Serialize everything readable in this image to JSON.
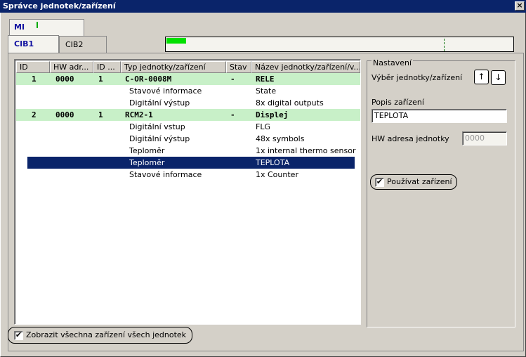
{
  "window": {
    "title": "Správce jednotek/zařízení",
    "close": "×"
  },
  "tabs_top": {
    "mi": "MI"
  },
  "tabs": [
    "CIB1",
    "CIB2"
  ],
  "list": {
    "headers": [
      "ID",
      "HW adr...",
      "ID ...",
      "Typ jednotky/zařízení",
      "Stav",
      "Název jednotky/zařízení/v..."
    ],
    "rows": [
      {
        "kind": "unit",
        "id": "1",
        "hw": "0000",
        "id2": "1",
        "type": "C-OR-0008M",
        "state": "-",
        "name": "RELE"
      },
      {
        "kind": "device",
        "type": "Stavové informace",
        "name": "State"
      },
      {
        "kind": "device",
        "type": "Digitální výstup",
        "name": "8x digital outputs"
      },
      {
        "kind": "unit",
        "id": "2",
        "hw": "0000",
        "id2": "1",
        "type": "RCM2-1",
        "state": "-",
        "name": "Displej"
      },
      {
        "kind": "device",
        "type": "Digitální vstup",
        "name": "FLG"
      },
      {
        "kind": "device",
        "type": "Digitální výstup",
        "name": "48x symbols"
      },
      {
        "kind": "device",
        "type": "Teploměr",
        "name": "1x internal thermo sensor"
      },
      {
        "kind": "device",
        "type": "Teploměr",
        "name": "TEPLOTA",
        "selected": true
      },
      {
        "kind": "device",
        "type": "Stavové informace",
        "name": "1x Counter"
      }
    ]
  },
  "settings": {
    "title": "Nastavení",
    "select_label": "Výběr jednotky/zařízení",
    "up_arrow": "↑",
    "down_arrow": "↓",
    "desc_label": "Popis zařízení",
    "desc_value": "TEPLOTA",
    "hw_label": "HW adresa jednotky",
    "hw_value": "0000",
    "use_device_label": "Používat zařízení",
    "use_device_checked": "✔"
  },
  "footer": {
    "show_all_label": "Zobrazit všechna zařízení všech jednotek",
    "show_all_checked": "✔"
  }
}
